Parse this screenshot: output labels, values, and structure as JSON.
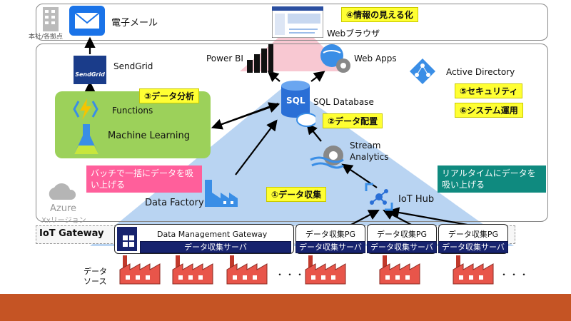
{
  "top": {
    "hq_label": "本社/各拠点",
    "email_label": "電子メール",
    "browser_label": "Webブラウザ",
    "visualize_label": "④情報の見える化"
  },
  "azure": {
    "label": "Azure",
    "region": "Xxリージョン",
    "sendgrid_label": "SendGrid",
    "sendgrid_logo": "SendGrid",
    "powerbi_label": "Power BI",
    "webapps_label": "Web Apps",
    "ad_label": "Active Directory",
    "analysis_label": "③データ分析",
    "functions_label": "Functions",
    "ml_label": "Machine Learning",
    "sql_label": "SQL Database",
    "sql_icon_text": "SQL",
    "placement_label": "②データ配置",
    "security_label": "⑤セキュリティ",
    "operation_label": "⑥システム運用",
    "stream_label_1": "Stream",
    "stream_label_2": "Analytics",
    "batch_note": "バッチで一括にデータを吸い上げる",
    "realtime_note": "リアルタイムにデータを吸い上げる",
    "datafactory_label": "Data Factory",
    "collect_label": "①データ収集",
    "iothub_label": "IoT Hub"
  },
  "gateway": {
    "title": "IoT Gateway",
    "dmg_label": "Data Management  Gateway",
    "server_label": "データ収集サーバ",
    "pg_label": "データ収集PG"
  },
  "bottom": {
    "source_label_1": "データ",
    "source_label_2": "ソース",
    "ellipsis": "・・・"
  },
  "colors": {
    "triangle_blue": "#7fb0e8",
    "triangle_pink": "#f4a3b4",
    "ml_green": "#9cd15a",
    "server_navy": "#17236e",
    "footer_orange": "#c55424",
    "highlight_yellow": "#ffff33",
    "note_pink": "#ff5f9b",
    "note_teal": "#0f8a7f"
  }
}
